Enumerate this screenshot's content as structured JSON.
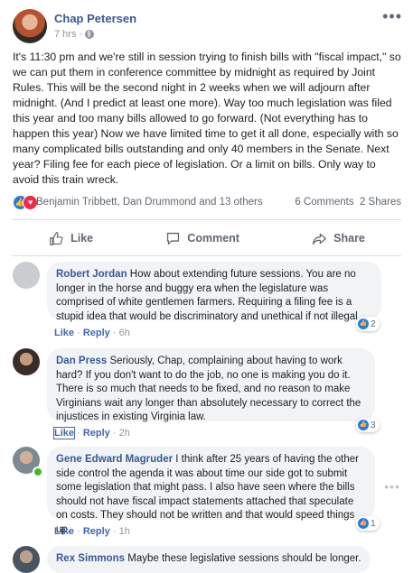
{
  "post": {
    "author": "Chap Petersen",
    "time": "7 hrs",
    "separator": "·",
    "more": "•••",
    "text": "It's 11:30 pm and we're still in session trying to finish bills with \"fiscal impact,\" so we can put them in conference committee by midnight as required by Joint Rules. This will be the second night in 2 weeks when we will adjourn after midnight. (And I predict at least one more). Way too much legislation was filed this year and too many bills allowed to go forward. (Not everything has to happen this year) Now we have limited time to get it all done, especially with so many complicated bills outstanding and only 40 members in the Senate. Next year? Filing fee for each piece of legislation. Or a limit on bills. Only way to avoid this train wreck.",
    "reactors": "Benjamin Tribbett, Dan Drummond and 13 others",
    "comments_count": "6 Comments",
    "shares_count": "2 Shares"
  },
  "actions": {
    "like": "Like",
    "comment": "Comment",
    "share": "Share"
  },
  "comments": [
    {
      "name": "Robert Jordan",
      "text": "How about extending future sessions. You are no longer in the horse and buggy era when the legislature was comprised of white gentlemen farmers. Requiring a filing fee is a stupid idea that would be discriminatory and unethical if not illegal.",
      "like": "Like",
      "reply": "Reply",
      "time": "6h",
      "reactions": "2"
    },
    {
      "name": "Dan Press",
      "text": "Seriously, Chap, complaining about having to work hard? If you don't want to do the job, no one is making you do it. There is so much that needs to be fixed, and no reason to make Virginians wait any longer than absolutely necessary to correct the injustices in existing Virginia law.",
      "like": "Like",
      "reply": "Reply",
      "time": "2h",
      "reactions": "3"
    },
    {
      "name": "Gene Edward Magruder",
      "text": "I think after 25 years of having the other side control the agenda it was about time our side got to submit some legislation that might pass. I also have seen where the bills should not have fiscal impact statements attached that speculate on costs. They should not be written and that would speed things up.",
      "like": "Like",
      "reply": "Reply",
      "time": "1h",
      "reactions": "1"
    },
    {
      "name": "Rex Simmons",
      "text": "Maybe these legislative sessions should be longer."
    }
  ],
  "dot": "·",
  "comment_more": "•••",
  "colors": {
    "link_blue": "#385898",
    "like_blue": "#2078f4",
    "love_red": "#f0284a",
    "bubble_bg": "#f2f3f5",
    "meta_gray": "#90949c"
  }
}
